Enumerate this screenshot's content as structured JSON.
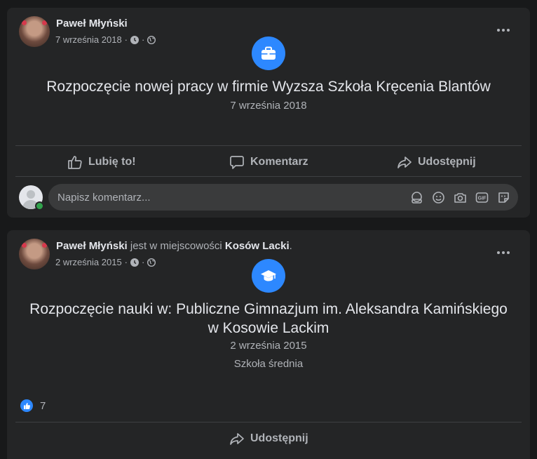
{
  "posts": [
    {
      "author": "Paweł Młyński",
      "date": "7 września 2018",
      "sep": "·",
      "event_icon": "briefcase-icon",
      "event_title": "Rozpoczęcie nowej pracy w firmie Wyzsza Szkoła Kręcenia Blantów",
      "event_date": "7 września 2018",
      "actions": {
        "like": "Lubię to!",
        "comment": "Komentarz",
        "share": "Udostępnij"
      },
      "comment_placeholder": "Napisz komentarz..."
    },
    {
      "author": "Paweł Młyński",
      "location_prefix": " jest w miejscowości ",
      "location": "Kosów Lacki",
      "location_suffix": ".",
      "date": "2 września 2015",
      "sep": "·",
      "event_icon": "graduation-cap-icon",
      "event_title_line1": "Rozpoczęcie nauki w: Publiczne Gimnazjum im. Aleksandra Kamińskiego",
      "event_title_line2": "w Kosowie Lackim",
      "event_date": "2 września 2015",
      "event_detail": "Szkoła średnia",
      "reaction_count": "7",
      "actions": {
        "share": "Udostępnij"
      }
    }
  ],
  "colors": {
    "accent": "#2d88ff",
    "card": "#242526",
    "background": "#18191a",
    "online": "#31a24c"
  }
}
